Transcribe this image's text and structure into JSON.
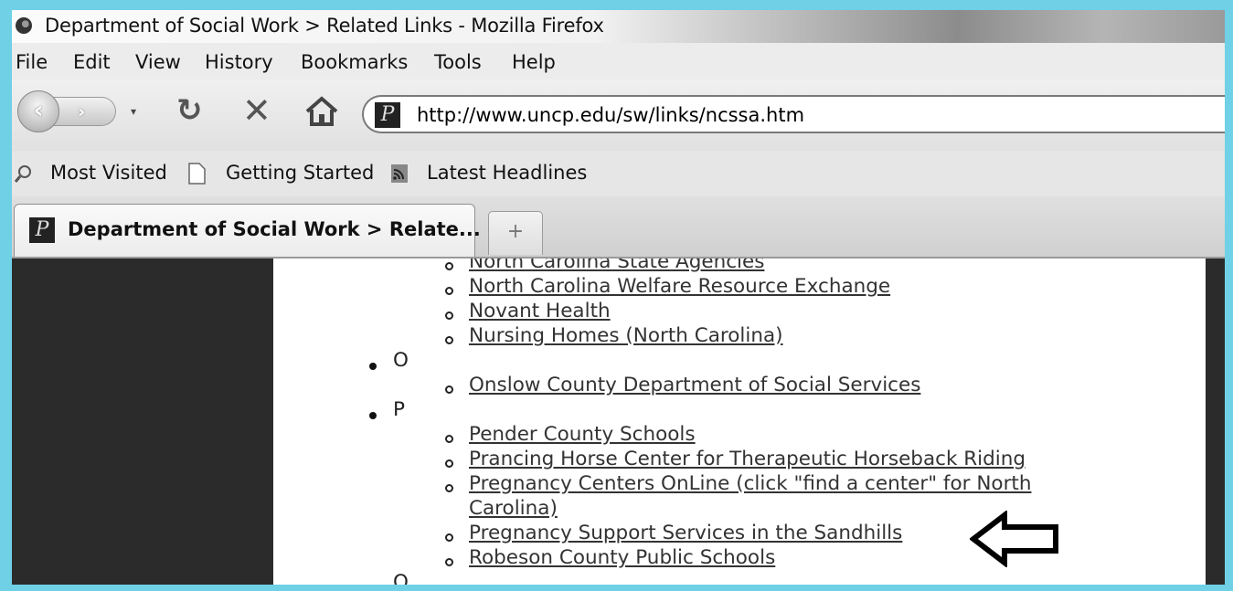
{
  "window": {
    "title": "Department of Social Work > Related Links - Mozilla Firefox"
  },
  "menu": [
    "File",
    "Edit",
    "View",
    "History",
    "Bookmarks",
    "Tools",
    "Help"
  ],
  "navigation": {
    "url": "http://www.uncp.edu/sw/links/ncssa.htm",
    "icons": [
      "back-icon",
      "forward-icon",
      "history-dropdown-icon",
      "reload-icon",
      "stop-icon",
      "home-icon"
    ]
  },
  "bookmarks": [
    "Most Visited",
    "Getting Started",
    "Latest Headlines"
  ],
  "tabs": {
    "active_title": "Department of Social Work > Relate...",
    "new_tab_symbol": "+"
  },
  "page": {
    "top_links": [
      "North Carolina State Agencies",
      "North Carolina Welfare Resource Exchange",
      "Novant Health",
      "Nursing Homes (North Carolina)"
    ],
    "section_o": "O",
    "o_links": [
      "Onslow County Department of Social Services"
    ],
    "section_p": "P",
    "p_links": [
      "Pender County Schools",
      "Prancing Horse Center for Therapeutic Horseback Riding",
      "Pregnancy Centers OnLine (click \"find a center\" for North",
      "Carolina)",
      "Pregnancy Support Services in the Sandhills",
      "Robeson County Public Schools"
    ],
    "section_next": "Q"
  },
  "colors": {
    "frame": "#6fd0e6",
    "sidebar": "#2b2b2b"
  }
}
